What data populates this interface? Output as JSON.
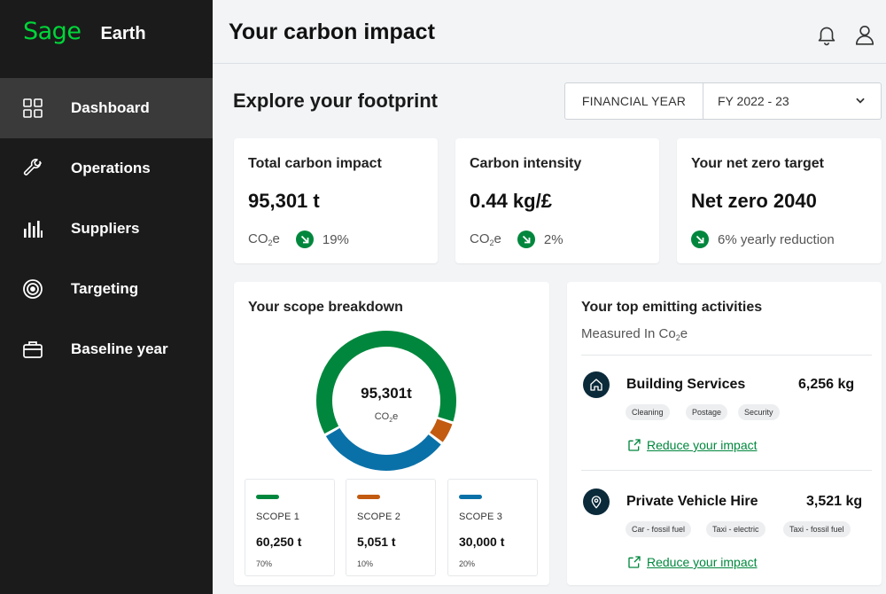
{
  "brand": {
    "logo": "Sage",
    "name": "Earth"
  },
  "nav": [
    {
      "label": "Dashboard",
      "icon": "grid-icon",
      "active": true
    },
    {
      "label": "Operations",
      "icon": "wrench-icon"
    },
    {
      "label": "Suppliers",
      "icon": "bar-chart-icon"
    },
    {
      "label": "Targeting",
      "icon": "target-icon"
    },
    {
      "label": "Baseline year",
      "icon": "briefcase-icon"
    }
  ],
  "header": {
    "title": "Your carbon impact",
    "icons": [
      "bell-icon",
      "user-icon"
    ]
  },
  "section": {
    "title": "Explore your footprint"
  },
  "period": {
    "label": "FINANCIAL YEAR",
    "value": "FY 2022 - 23"
  },
  "stats": [
    {
      "title": "Total carbon impact",
      "value": "95,301 t",
      "unit": "CO",
      "unit_sub": "2",
      "unit_end": "e",
      "change": "19%"
    },
    {
      "title": "Carbon intensity",
      "value": "0.44 kg/£",
      "unit": "CO",
      "unit_sub": "2",
      "unit_end": "e",
      "change": "2%"
    },
    {
      "title": "Your net zero target",
      "value": "Net zero 2040",
      "change": "6% yearly reduction"
    }
  ],
  "scope": {
    "title": "Your scope breakdown",
    "total": "95,301t",
    "unit": "CO",
    "unit_sub": "2",
    "unit_end": "e",
    "items": [
      {
        "name": "SCOPE 1",
        "value": "60,250 t",
        "pct": "70%",
        "share": 60250,
        "color": "#00873d"
      },
      {
        "name": "SCOPE 2",
        "value": "5,051 t",
        "pct": "10%",
        "share": 5051,
        "color": "#c25a10"
      },
      {
        "name": "SCOPE 3",
        "value": "30,000 t",
        "pct": "20%",
        "share": 30000,
        "color": "#0a71a8"
      }
    ]
  },
  "activities": {
    "title": "Your top emitting activities",
    "subtitle": "Measured In Co",
    "subtitle_sub": "2",
    "subtitle_end": "e",
    "items": [
      {
        "name": "Building Services",
        "value": "6,256 kg",
        "icon": "home-icon",
        "tags": [
          "Cleaning",
          "Postage",
          "Security"
        ],
        "link": "Reduce your impact"
      },
      {
        "name": "Private Vehicle Hire",
        "value": "3,521 kg",
        "icon": "location-pin-icon",
        "tags": [
          "Car - fossil fuel",
          "Taxi - electric",
          "Taxi - fossil fuel"
        ],
        "link": "Reduce your impact"
      }
    ]
  }
}
